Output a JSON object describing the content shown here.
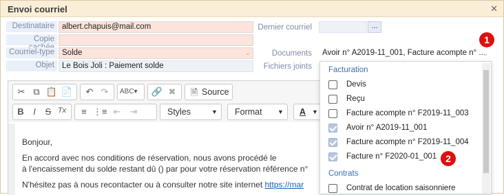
{
  "window": {
    "title": "Envoi courriel",
    "close_glyph": "✕"
  },
  "form": {
    "destinataire": {
      "label": "Destinataire",
      "value": "albert.chapuis@mail.com"
    },
    "copie_cachee": {
      "label": "Copie cachée",
      "value": ""
    },
    "courriel_type": {
      "label": "Courriel-type",
      "value": "Solde"
    },
    "objet": {
      "label": "Objet",
      "value": "Le Bois Joli : Paiement solde"
    },
    "dernier_courriel": {
      "label": "Dernier courriel",
      "value": "",
      "button": "..."
    },
    "documents": {
      "label": "Documents",
      "value": "Avoir n° A2019-11_001, Facture acompte n° ..."
    },
    "fichiers_joints": {
      "label": "Fichiers joints"
    }
  },
  "badges": [
    "1",
    "2"
  ],
  "toolbar": {
    "source_label": "Source",
    "styles_label": "Styles",
    "format_label": "Format",
    "bold": "B",
    "italic": "I",
    "strike": "S",
    "clear_format": "Tx",
    "font_color": "A"
  },
  "editor": {
    "greeting": "Bonjour,",
    "line1": "En accord avec nos conditions de réservation, nous avons procédé le",
    "line2": "à l'encaissement du solde restant dû () par pour votre réservation référence n°",
    "line3_text": "N'hésitez pas à nous recontacter ou à consulter notre site internet ",
    "line3_link": "https://mar"
  },
  "dropdown": {
    "groups": [
      {
        "name": "Facturation",
        "items": [
          {
            "label": "Devis",
            "checked": false
          },
          {
            "label": "Reçu",
            "checked": false
          },
          {
            "label": "Facture acompte n° F2019-11_003",
            "checked": false
          },
          {
            "label": "Avoir n° A2019-11_001",
            "checked": true
          },
          {
            "label": "Facture acompte n° F2019-11_004",
            "checked": true
          },
          {
            "label": "Facture n° F2020-01_001",
            "checked": true
          }
        ]
      },
      {
        "name": "Contrats",
        "items": [
          {
            "label": "Contrat de location saisonniere",
            "checked": false
          }
        ]
      }
    ]
  },
  "colors": {
    "accent_red": "#e00f0f",
    "title_bg": "#fbeed6",
    "field_pink": "#fbe4dc",
    "label_blue": "#7f8ba3"
  }
}
